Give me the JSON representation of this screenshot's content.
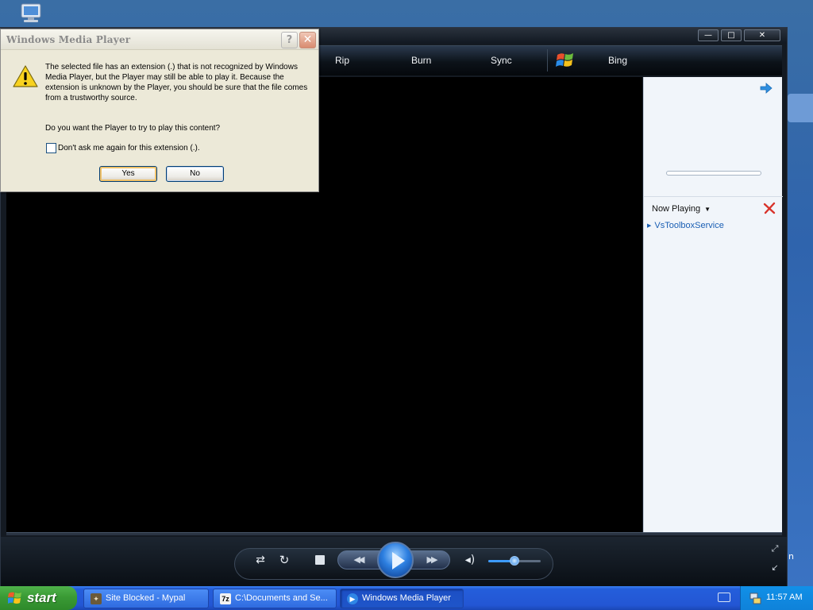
{
  "wmp": {
    "nav": {
      "rip": "Rip",
      "burn": "Burn",
      "sync": "Sync",
      "bing": "Bing"
    },
    "window_buttons": {
      "minimize": "—",
      "maximize": "□",
      "close": "✕"
    },
    "list_pane": {
      "now_playing": "Now Playing",
      "playlist_items": [
        "VsToolboxService"
      ]
    },
    "controls": {
      "shuffle_glyph": "⇄",
      "repeat_glyph": "↻",
      "prev_glyph": "◀◀",
      "next_glyph": "▶▶",
      "mute_glyph": "◂)",
      "volume_level": 0.5
    }
  },
  "dialog": {
    "title": "Windows Media Player",
    "help_label": "?",
    "close_label": "✕",
    "message": "The selected file has an extension (.) that is not recognized by Windows Media Player, but the Player may still be able to play it. Because the extension is unknown by the Player, you should be sure that the file comes from a trustworthy source.",
    "question": "Do you want the Player to try to play this content?",
    "checkbox_label": "Don't ask me again for this extension (.).",
    "yes_label": "Yes",
    "no_label": "No"
  },
  "taskbar": {
    "start_label": "start",
    "tasks": [
      {
        "label": "Site Blocked - Mypal",
        "icon": "mypal-icon",
        "active": false
      },
      {
        "label": "C:\\Documents and Se...",
        "icon": "7zip-icon",
        "active": false
      },
      {
        "label": "Windows Media Player",
        "icon": "wmp-icon",
        "active": true
      }
    ],
    "clock": "11:57 AM",
    "task_icon_glyphs": {
      "7zip": "7z",
      "wmp": "▶"
    }
  },
  "desktop": {
    "partial_text": "in"
  },
  "colors": {
    "wmp_frame": "#141a22",
    "dialog_bg": "#ece9d8",
    "taskbar_blue": "#245edb",
    "start_green": "#3a9a35",
    "link_blue": "#1a5fb4",
    "play_blue": "#2d7fe0"
  }
}
